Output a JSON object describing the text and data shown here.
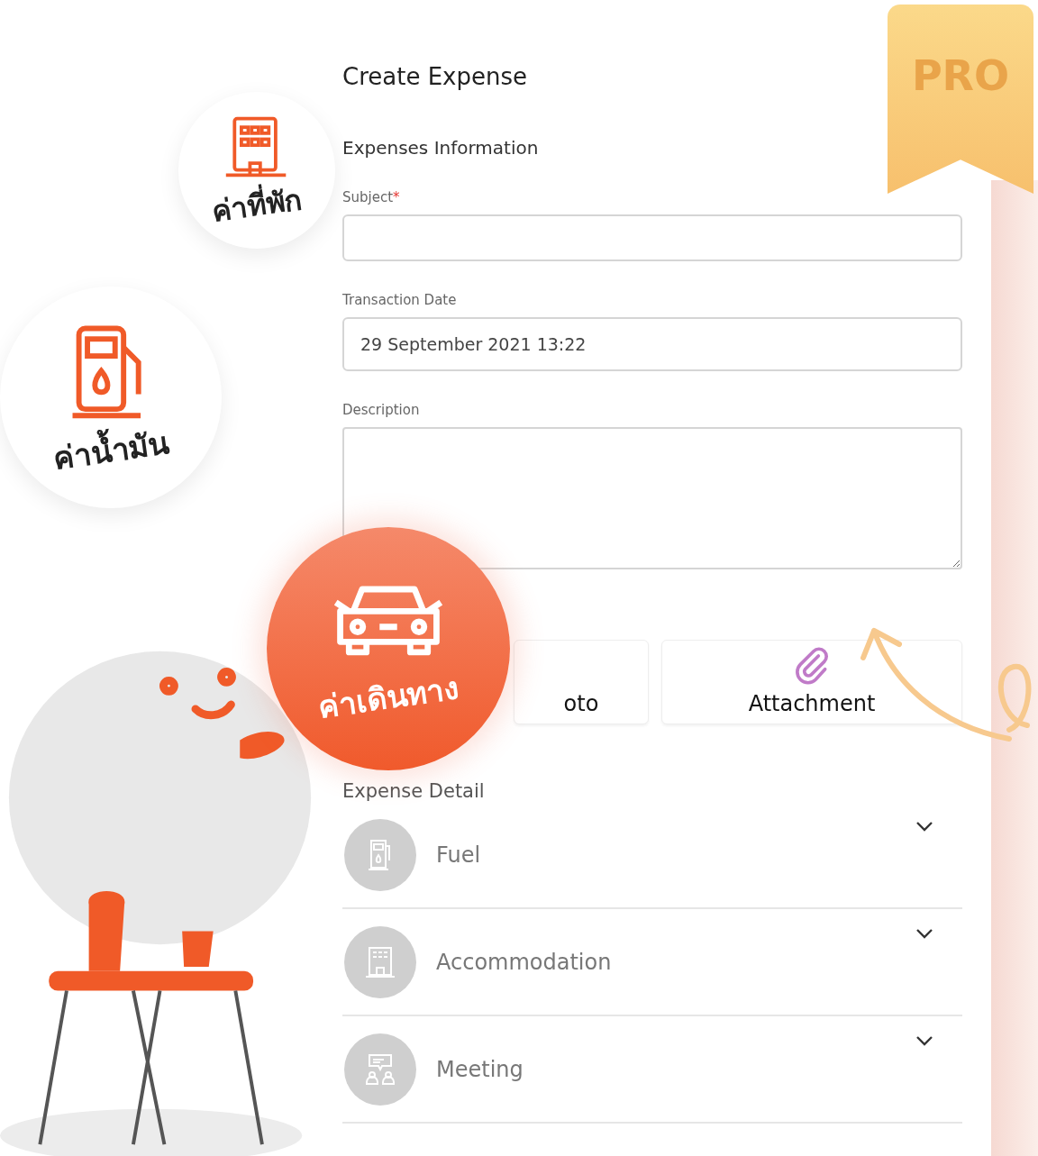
{
  "ribbon": {
    "label": "PRO"
  },
  "form": {
    "title": "Create Expense",
    "section": "Expenses Information",
    "fields": [
      {
        "label": "Subject",
        "required_mark": "*",
        "kind": "input"
      },
      {
        "label": "Transaction Date",
        "kind": "input",
        "value": "29 September 2021 13:22"
      },
      {
        "label": "Description",
        "kind": "textarea"
      }
    ],
    "uploads": [
      {
        "label": "oto",
        "kind": "photo"
      },
      {
        "label": "Attachment",
        "kind": "attachment"
      }
    ],
    "detail_title": "Expense Detail",
    "details": [
      {
        "label": "Fuel",
        "kind": "fuel",
        "expanded": false
      },
      {
        "label": "Accommodation",
        "kind": "hotel",
        "expanded": false
      },
      {
        "label": "Meeting",
        "kind": "meeting",
        "expanded": false
      }
    ]
  },
  "badges": [
    {
      "label": "ค่าที่พัก",
      "kind": "hotel"
    },
    {
      "label": "ค่าน้ำมัน",
      "kind": "fuel"
    },
    {
      "label": "ค่าเดินทาง",
      "kind": "car"
    }
  ]
}
